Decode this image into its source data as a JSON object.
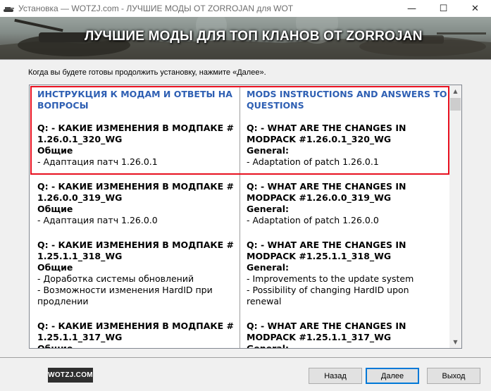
{
  "window": {
    "title": "Установка — WOTZJ.com - ЛУЧШИЕ МОДЫ ОТ ZORROJAN для WOT",
    "controls": {
      "minimize": "—",
      "maximize": "☐",
      "close": "✕"
    }
  },
  "banner": {
    "headline": "ЛУЧШИЕ МОДЫ ДЛЯ ТОП КЛАНОВ ОТ ZORROJAN"
  },
  "instruction": "Когда вы будете готовы продолжить установку, нажмите «Далее».",
  "content": {
    "header": {
      "left": [
        "ИНСТРУКЦИЯ К МОДАМ И ОТВЕТЫ НА",
        "ВОПРОСЫ"
      ],
      "right": [
        "MODS INSTRUCTIONS AND ANSWERS TO",
        "QUESTIONS"
      ]
    },
    "entries": [
      {
        "left": {
          "q": [
            "Q: - КАКИЕ ИЗМЕНЕНИЯ В МОДПАКЕ #",
            "1.26.0.1_320_WG"
          ],
          "section": "Общие",
          "items": [
            "- Адаптация патч 1.26.0.1"
          ]
        },
        "right": {
          "q": [
            "Q: - WHAT ARE THE CHANGES IN",
            "MODPACK #1.26.0.1_320_WG"
          ],
          "section": "General:",
          "items": [
            "- Adaptation of patch 1.26.0.1"
          ]
        }
      },
      {
        "left": {
          "q": [
            "Q: - КАКИЕ ИЗМЕНЕНИЯ В МОДПАКЕ #",
            "1.26.0.0_319_WG"
          ],
          "section": "Общие",
          "items": [
            "- Адаптация патч 1.26.0.0"
          ]
        },
        "right": {
          "q": [
            "Q: - WHAT ARE THE CHANGES IN",
            "MODPACK #1.26.0.0_319_WG"
          ],
          "section": "General:",
          "items": [
            "- Adaptation of patch 1.26.0.0"
          ]
        }
      },
      {
        "left": {
          "q": [
            "Q: - КАКИЕ ИЗМЕНЕНИЯ В МОДПАКЕ #",
            "1.25.1.1_318_WG"
          ],
          "section": "Общие",
          "items": [
            "- Доработка системы обновлений",
            "- Возможности изменения HardID при",
            "продлении"
          ]
        },
        "right": {
          "q": [
            "Q: - WHAT ARE THE CHANGES IN",
            "MODPACK #1.25.1.1_318_WG"
          ],
          "section": "General:",
          "items": [
            "- Improvements to the update system",
            "- Possibility of changing HardID upon",
            "renewal"
          ]
        }
      },
      {
        "left": {
          "q": [
            "Q: - КАКИЕ ИЗМЕНЕНИЯ В МОДПАКЕ #",
            "1.25.1.1_317_WG"
          ],
          "section": "Общие",
          "items": []
        },
        "right": {
          "q": [
            "Q: - WHAT ARE THE CHANGES IN",
            "MODPACK #1.25.1.1_317_WG"
          ],
          "section": "General:",
          "items": []
        }
      }
    ]
  },
  "footer": {
    "logo": "WOTZJ.COM",
    "back": "Назад",
    "next": "Далее",
    "exit": "Выход"
  },
  "colors": {
    "heading": "#2e5fb3",
    "highlight": "#e8101f",
    "default_button_border": "#0078d7"
  }
}
